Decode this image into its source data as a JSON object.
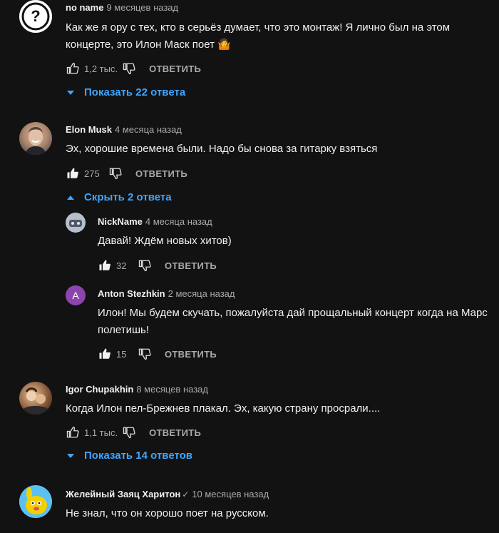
{
  "reply_label": "ОТВЕТИТЬ",
  "comments": [
    {
      "author": "no name",
      "time": "9 месяцев назад",
      "text": "Как же я ору с тех, кто в серьёз думает, что это монтаж! Я лично был на этом концерте, это Илон Маск поет 🤷",
      "likes": "1,2 тыс.",
      "replies_toggle": "Показать 22 ответа"
    },
    {
      "author": "Elon Musk",
      "time": "4 месяца назад",
      "text": "Эх, хорошие времена были. Надо бы снова за гитарку взяться",
      "likes": "275",
      "replies_toggle": "Скрыть 2 ответа",
      "replies": [
        {
          "author": "NickName",
          "time": "4 месяца назад",
          "text": "Давай! Ждём новых хитов)",
          "likes": "32"
        },
        {
          "author": "Anton Stezhkin",
          "time": "2 месяца назад",
          "text": "Илон! Мы будем скучать, пожалуйста дай прощальный концерт когда на Марс полетишь!",
          "likes": "15",
          "avatar_letter": "A"
        }
      ]
    },
    {
      "author": "Igor Chupakhin",
      "time": "8 месяцев назад",
      "text": "Когда Илон пел-Брежнев плакал. Эх, какую страну просрали....",
      "likes": "1,1 тыс.",
      "replies_toggle": "Показать 14 ответов"
    },
    {
      "author": "Желейный Заяц Харитон",
      "time": "10 месяцев назад",
      "text": "Не знал, что он хорошо поет на русском."
    }
  ],
  "colors": {
    "background": "#121212",
    "link": "#3ea6ff",
    "muted": "#aaaaaa",
    "anton_avatar": "#8e44ad"
  }
}
